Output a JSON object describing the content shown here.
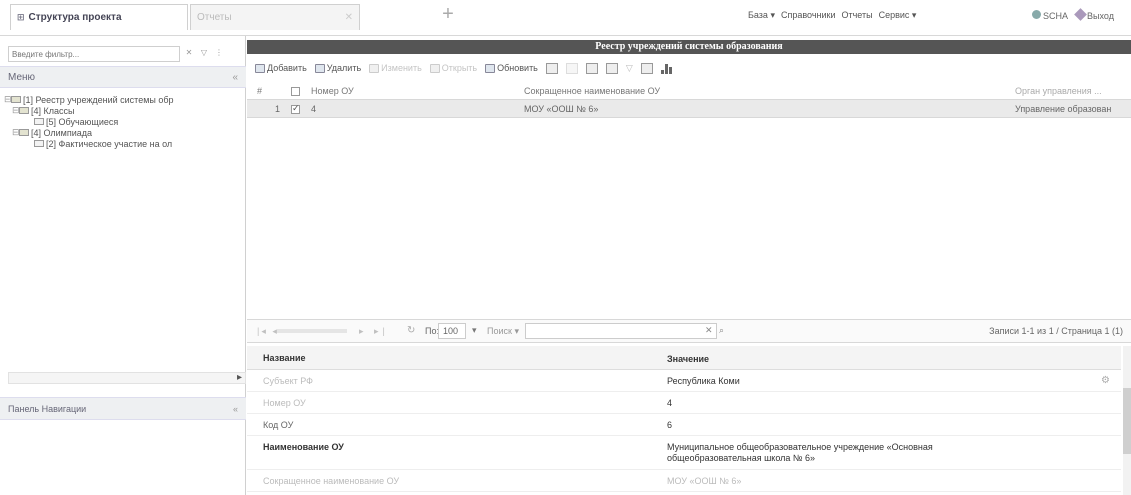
{
  "topbar": {
    "tabs": [
      {
        "label": "Структура проекта",
        "active": true
      },
      {
        "label": "Отчеты",
        "active": false
      }
    ],
    "add_tab": "+",
    "menu": [
      "База ▾",
      "Справочники",
      "Отчеты",
      "Сервис ▾"
    ],
    "user": "SCHA",
    "logout": "Выход"
  },
  "left": {
    "filter_placeholder": "Введите фильтр...",
    "menu_title": "Меню",
    "tree": [
      {
        "level": 0,
        "label": "[1] Реестр учреждений системы обр",
        "folder": true
      },
      {
        "level": 1,
        "label": "[4] Классы",
        "folder": true
      },
      {
        "level": 2,
        "label": "[5] Обучающиеся",
        "folder": false
      },
      {
        "level": 1,
        "label": "[4] Олимпиада",
        "folder": true
      },
      {
        "level": 2,
        "label": "[2] Фактическое участие на ол",
        "folder": false
      }
    ],
    "nav_title": "Панель Навигации"
  },
  "main": {
    "title": "Реестр учреждений системы образования",
    "toolbar": {
      "add": "Добавить",
      "delete": "Удалить",
      "change": "Изменить",
      "view": "Открыть",
      "refresh": "Обновить"
    },
    "grid": {
      "headers": {
        "num": "#",
        "ou_num": "Номер ОУ",
        "short_name": "Сокращенное наименование ОУ",
        "org": "Орган управления ..."
      },
      "rows": [
        {
          "num": "1",
          "checked": true,
          "ou_num": "4",
          "short_name": "МОУ «ООШ № 6»",
          "org": "Управление образован"
        }
      ]
    },
    "pager": {
      "per_page_label": "По:",
      "per_page": "100",
      "search_label": "Поиск ▾",
      "records": "Записи 1-1 из 1 / Страница 1 (1)"
    },
    "props": {
      "header_name": "Название",
      "header_value": "Значение",
      "rows": [
        {
          "name": "Субъект РФ",
          "value": "Республика Коми",
          "style": "dim"
        },
        {
          "name": "Номер ОУ",
          "value": "4",
          "style": "dim"
        },
        {
          "name": "Код ОУ",
          "value": "6",
          "style": "normal"
        },
        {
          "name": "Наименование ОУ",
          "value": "Муниципальное общеобразовательное учреждение «Основная общеобразовательная школа № 6»",
          "style": "bold"
        },
        {
          "name": "Сокращенное наименование ОУ",
          "value": "МОУ «ООШ № 6»",
          "style": "dim"
        }
      ]
    }
  },
  "icons": {
    "tab": "grid-icon",
    "add_tab": "plus-icon",
    "user": "user-icon",
    "logout": "exit-icon",
    "toolbar": [
      "add-icon",
      "delete-icon",
      "edit-icon",
      "view-icon",
      "refresh-icon",
      "chart-icon"
    ]
  }
}
